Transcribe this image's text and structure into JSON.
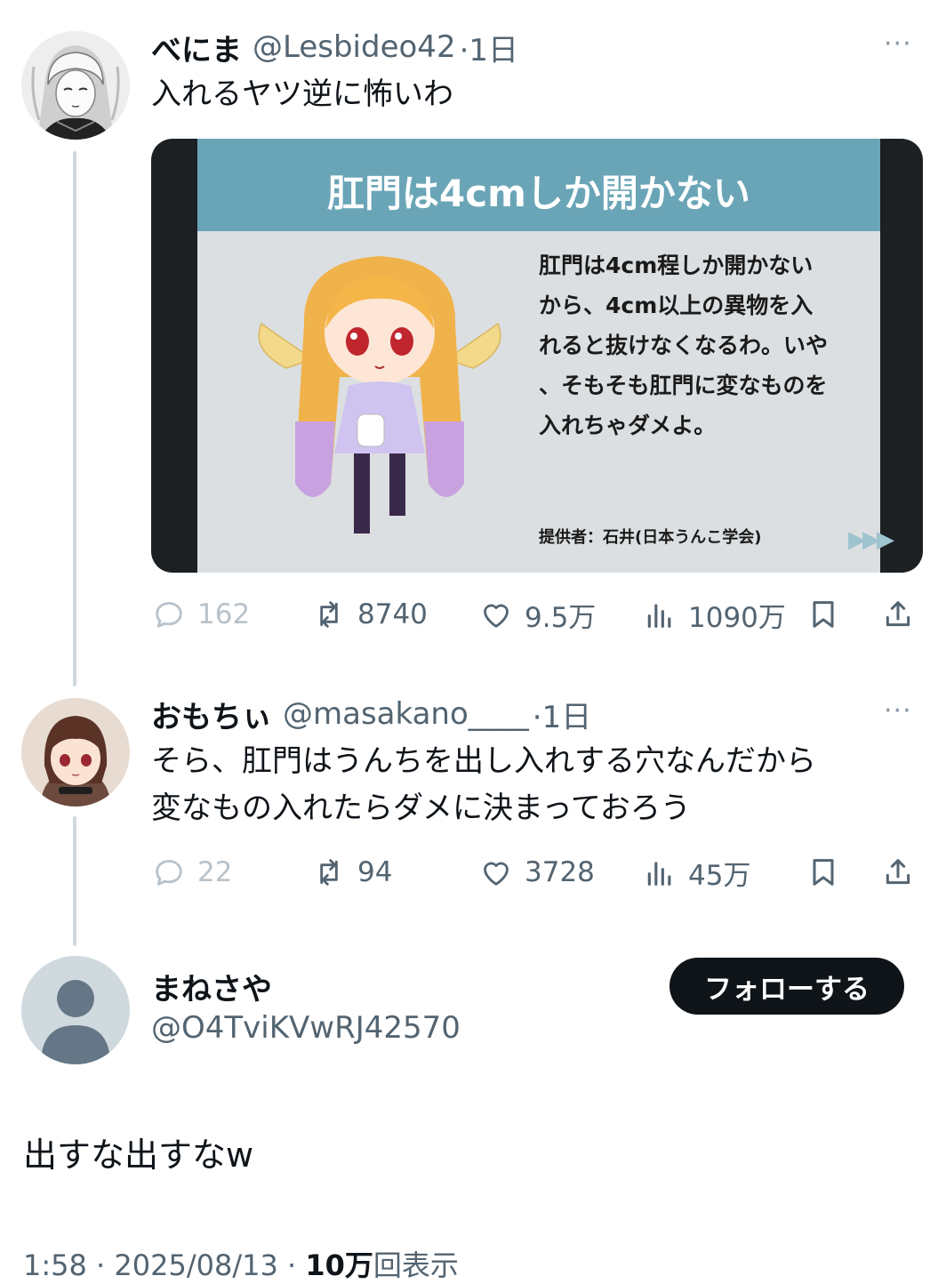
{
  "tweet1": {
    "name": "べにま",
    "handle": "@Lesbideo42",
    "time": "·1日",
    "more": "···",
    "text": "入れるヤツ逆に怖いわ",
    "media": {
      "title": "肛門は4cmしか開かない",
      "body_lines": [
        "肛門は4cm程しか開かない",
        "から、4cm以上の異物を入",
        "れると抜けなくなるわ。いや",
        "、そもそも肛門に変なものを",
        "入れちゃダメよ。"
      ],
      "credit": "提供者：石井(日本うんこ学会)",
      "arrows": "▶▶▶"
    },
    "actions": {
      "reply": "162",
      "retweet": "8740",
      "like": "9.5万",
      "views": "1090万"
    }
  },
  "tweet2": {
    "name": "おもちぃ",
    "handle": "@masakano____",
    "time": "·1日",
    "more": "···",
    "text_lines": [
      "そら、肛門はうんちを出し入れする穴なんだから",
      "変なもの入れたらダメに決まっておろう"
    ],
    "actions": {
      "reply": "22",
      "retweet": "94",
      "like": "3728",
      "views": "45万"
    }
  },
  "main_tweet": {
    "name": "まねさや",
    "handle": "@O4TviKVwRJ42570",
    "follow_label": "フォローする",
    "text": "出すな出すなw",
    "meta": {
      "time": "1:58",
      "sep1": "·",
      "date": "2025/08/13",
      "sep2": "·",
      "views_count": "10万",
      "views_label": "回表示"
    }
  },
  "colors": {
    "text": "#0f1419",
    "secondary": "#536471",
    "thread_line": "#cfd9de",
    "slide_header": "#6aa5b7",
    "button": "#0f1419"
  }
}
